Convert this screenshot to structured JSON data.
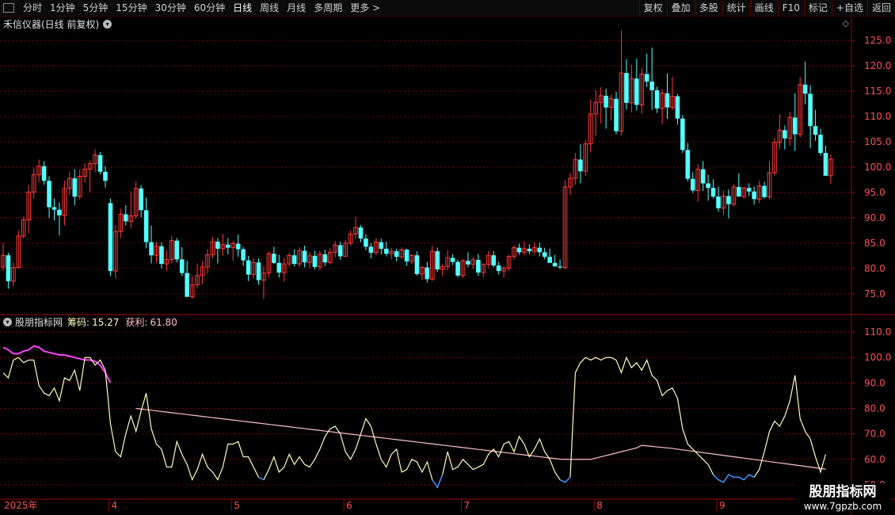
{
  "toolbar": {
    "periods": [
      "分时",
      "1分钟",
      "5分钟",
      "15分钟",
      "30分钟",
      "60分钟",
      "日线",
      "周线",
      "月线",
      "多周期",
      "更多 >"
    ],
    "active": "日线",
    "right_buttons": [
      "复权",
      "叠加",
      "多股",
      "统计",
      "画线",
      "F10",
      "标记",
      "+自选",
      "返回"
    ]
  },
  "main_panel": {
    "title": "禾信仪器(日线 前复权)",
    "price_axis": [
      "125.0",
      "120.0",
      "115.0",
      "110.0",
      "105.0",
      "100.0",
      "95.0",
      "90.0",
      "85.0",
      "80.0",
      "75.0"
    ]
  },
  "indicator_panel": {
    "name": "股朋指标网",
    "chip_label": "筹码:",
    "chip_value": "15.27",
    "profit_label": "获利:",
    "profit_value": "61.80",
    "axis": [
      "110.0",
      "100.0",
      "90.0",
      "80.0",
      "70.0",
      "60.0",
      "50.0"
    ]
  },
  "date_axis": [
    "2025年",
    "4",
    "5",
    "6",
    "7",
    "8",
    "9"
  ],
  "watermark": {
    "line1": "股朋指标网",
    "line2": "www.7gpzb.com"
  },
  "colors": {
    "up": "#ff3a3a",
    "down": "#54ffff",
    "grid": "#7a0000",
    "line_main": "#ffffc0",
    "line_avg": "#ffc0cb",
    "line_hi": "#ff40ff",
    "line_lo": "#3a8cff"
  },
  "chart_data": {
    "type": "candlestick",
    "price_ylim": [
      72,
      128
    ],
    "indicator_ylim": [
      45,
      115
    ],
    "month_boundaries": {
      "4": 21,
      "5": 45,
      "6": 67,
      "7": 90,
      "8": 116,
      "9": 140
    },
    "candles_ohlc": [
      [
        80.3,
        85.1,
        79.5,
        82.6
      ],
      [
        82.6,
        83.1,
        76,
        77.5
      ],
      [
        77.5,
        81.2,
        76.5,
        80.2
      ],
      [
        80.2,
        87.5,
        80,
        86.4
      ],
      [
        86.4,
        90.3,
        85.9,
        89.6
      ],
      [
        89.6,
        96.5,
        87,
        95.1
      ],
      [
        95.1,
        99.8,
        93.8,
        98.5
      ],
      [
        98.5,
        101.5,
        97,
        100.2
      ],
      [
        100.2,
        101.2,
        96.5,
        97.3
      ],
      [
        97.3,
        98.2,
        90,
        92.1
      ],
      [
        92.1,
        93.8,
        89.5,
        91.6
      ],
      [
        91.6,
        93,
        86.5,
        90.5
      ],
      [
        90.5,
        97.3,
        88.5,
        95.8
      ],
      [
        95.8,
        99,
        94.5,
        97.8
      ],
      [
        97.8,
        99.6,
        92.5,
        94.2
      ],
      [
        94.2,
        99.5,
        93.7,
        98.2
      ],
      [
        98.2,
        100.8,
        97,
        99.6
      ],
      [
        99.6,
        101.3,
        95,
        100.7
      ],
      [
        100.7,
        103.5,
        99,
        102.4
      ],
      [
        102.4,
        103,
        98.6,
        99.1
      ],
      [
        99.1,
        100.2,
        96,
        97.3
      ],
      [
        92.9,
        93.8,
        78.5,
        79.5
      ],
      [
        79.5,
        88.6,
        78,
        87.3
      ],
      [
        87.3,
        91.8,
        86,
        90.7
      ],
      [
        90.7,
        92.5,
        88.5,
        89.3
      ],
      [
        89.3,
        95.2,
        88,
        90.4
      ],
      [
        90.4,
        97.2,
        89.8,
        95.8
      ],
      [
        95.8,
        96.5,
        90.1,
        91.5
      ],
      [
        91.5,
        94,
        84,
        85.2
      ],
      [
        85.2,
        88.5,
        81,
        82.6
      ],
      [
        82.6,
        85.3,
        81.2,
        84.4
      ],
      [
        84.4,
        85.2,
        80,
        80.9
      ],
      [
        80.9,
        83.5,
        79.5,
        81.8
      ],
      [
        81.8,
        86.5,
        81,
        85.5
      ],
      [
        85.5,
        86,
        81.2,
        81.8
      ],
      [
        81.8,
        84.2,
        78.5,
        79.1
      ],
      [
        79.1,
        81.5,
        75,
        74.4
      ],
      [
        74.4,
        78.5,
        74,
        76.8
      ],
      [
        76.8,
        81,
        76,
        78.6
      ],
      [
        78.6,
        81.5,
        77,
        80.3
      ],
      [
        80.3,
        83.8,
        79,
        82.7
      ],
      [
        82.7,
        86.2,
        82,
        85.3
      ],
      [
        85.3,
        86,
        81,
        83.9
      ],
      [
        83.9,
        86.8,
        82.5,
        84.7
      ],
      [
        84.7,
        86,
        82.8,
        84.1
      ],
      [
        84.1,
        85.5,
        81.5,
        84.9
      ],
      [
        84.9,
        86.7,
        82.3,
        83.8
      ],
      [
        83.8,
        84.2,
        80.5,
        81.6
      ],
      [
        81.6,
        82.5,
        77.5,
        78.8
      ],
      [
        78.8,
        82,
        78,
        81.2
      ],
      [
        81.2,
        82,
        76.8,
        77.7
      ],
      [
        77.7,
        80.5,
        74,
        79.1
      ],
      [
        79.1,
        83.4,
        78.2,
        82.9
      ],
      [
        82.9,
        84.3,
        80.9,
        81.1
      ],
      [
        81.1,
        82.7,
        78.2,
        79.2
      ],
      [
        79.2,
        82.1,
        77.4,
        80.9
      ],
      [
        80.9,
        83.1,
        80.3,
        82.6
      ],
      [
        82.6,
        83.8,
        80.4,
        80.9
      ],
      [
        80.9,
        84.2,
        80.2,
        83.5
      ],
      [
        83.5,
        84.5,
        80.2,
        81.2
      ],
      [
        81.2,
        83.2,
        80.1,
        82.5
      ],
      [
        82.5,
        83.5,
        79.8,
        80.3
      ],
      [
        80.3,
        83.5,
        79.7,
        82.8
      ],
      [
        82.8,
        83.7,
        80.5,
        81.2
      ],
      [
        81.2,
        84,
        80.8,
        83.2
      ],
      [
        83.2,
        85.4,
        82.2,
        84.6
      ],
      [
        84.6,
        85.3,
        81.7,
        82.4
      ],
      [
        82.4,
        85.6,
        82.3,
        85
      ],
      [
        85,
        87.5,
        84.5,
        86.8
      ],
      [
        86.8,
        90.2,
        85.8,
        88.1
      ],
      [
        88.1,
        88.6,
        85.2,
        85.9
      ],
      [
        85.9,
        86.8,
        83.6,
        84.3
      ],
      [
        84.3,
        85,
        82,
        83.1
      ],
      [
        83.1,
        86,
        82.7,
        85.2
      ],
      [
        85.2,
        85.9,
        82.8,
        83.9
      ],
      [
        83.9,
        85.3,
        82.4,
        82.9
      ],
      [
        82.9,
        84.1,
        81.8,
        83.4
      ],
      [
        83.4,
        83.9,
        81.4,
        82.3
      ],
      [
        82.3,
        84.2,
        81.9,
        83.7
      ],
      [
        83.7,
        83.9,
        80.5,
        81.4
      ],
      [
        81.4,
        82.9,
        80.9,
        82.6
      ],
      [
        82.6,
        83.4,
        78.6,
        78.9
      ],
      [
        78.9,
        80.5,
        77.7,
        80.2
      ],
      [
        80.2,
        81.3,
        77.2,
        77.9
      ],
      [
        77.9,
        84.5,
        77.5,
        83.4
      ],
      [
        83.4,
        84.1,
        79.3,
        79.8
      ],
      [
        79.8,
        80.9,
        78.5,
        80.4
      ],
      [
        80.4,
        83.6,
        79.6,
        82.1
      ],
      [
        82.1,
        82.8,
        80.7,
        81.3
      ],
      [
        81.3,
        81.7,
        78.2,
        78.6
      ],
      [
        78.6,
        81.9,
        78.2,
        81.5
      ],
      [
        81.5,
        83.2,
        80.2,
        80.8
      ],
      [
        80.8,
        82.3,
        79.9,
        81.7
      ],
      [
        81.7,
        82.9,
        78.5,
        79.2
      ],
      [
        79.2,
        81,
        78.3,
        80.8
      ],
      [
        80.8,
        83.5,
        80.1,
        82.6
      ],
      [
        82.6,
        83.4,
        80.2,
        80.6
      ],
      [
        80.6,
        81.3,
        78.8,
        79.5
      ],
      [
        79.5,
        80.5,
        78.2,
        80.1
      ],
      [
        80.1,
        82.7,
        79.5,
        82.4
      ],
      [
        82.4,
        84.6,
        81.8,
        84.1
      ],
      [
        84.1,
        84.9,
        82.7,
        83.2
      ],
      [
        83.2,
        85.4,
        82.6,
        83.9
      ],
      [
        83.9,
        84.8,
        82.8,
        83.4
      ],
      [
        83.4,
        85.2,
        82.8,
        84.1
      ],
      [
        84.1,
        85.1,
        82.4,
        83.2
      ],
      [
        83.2,
        84.1,
        81.8,
        82.3
      ],
      [
        82.3,
        83.9,
        81.7,
        81.1
      ],
      [
        81.1,
        82.7,
        80.4,
        80.4
      ],
      [
        80.4,
        81.8,
        79.9,
        80.2
      ],
      [
        80.2,
        97.5,
        79.8,
        96.1
      ],
      [
        96.1,
        98.9,
        94.5,
        97.8
      ],
      [
        97.8,
        102.8,
        96.6,
        101.5
      ],
      [
        101.5,
        104.5,
        96.8,
        99.2
      ],
      [
        99.2,
        105.3,
        98.3,
        104.6
      ],
      [
        104.6,
        113.4,
        102.9,
        110.5
      ],
      [
        110.5,
        115.2,
        106.2,
        112.8
      ],
      [
        112.8,
        115.8,
        108.6,
        114.1
      ],
      [
        114.1,
        115.5,
        107.6,
        111.8
      ],
      [
        111.8,
        114.3,
        109.2,
        113.5
      ],
      [
        113.5,
        114.9,
        106.5,
        107.1
      ],
      [
        107.1,
        127,
        106.3,
        118.6
      ],
      [
        118.6,
        121.3,
        111.4,
        112.7
      ],
      [
        112.7,
        120.2,
        110.8,
        117.5
      ],
      [
        117.5,
        121.4,
        111.2,
        112.3
      ],
      [
        112.3,
        119.6,
        110.5,
        118.4
      ],
      [
        118.4,
        122.4,
        115.8,
        116.9
      ],
      [
        116.9,
        123.6,
        111.3,
        115.2
      ],
      [
        115.2,
        115.9,
        110.7,
        111.6
      ],
      [
        111.6,
        115.4,
        108.5,
        114.6
      ],
      [
        114.6,
        118.5,
        109.5,
        111.8
      ],
      [
        111.8,
        117.8,
        111.2,
        114
      ],
      [
        114,
        114.5,
        108.4,
        109.6
      ],
      [
        109.6,
        110.3,
        102.8,
        103.4
      ],
      [
        103.4,
        104.8,
        97.2,
        97.7
      ],
      [
        97.7,
        99,
        94.9,
        95.4
      ],
      [
        95.4,
        100.6,
        93.2,
        99.6
      ],
      [
        99.6,
        101.2,
        95.3,
        96.8
      ],
      [
        96.8,
        98.5,
        93.4,
        95.9
      ],
      [
        95.9,
        97.6,
        93.8,
        94.2
      ],
      [
        94.2,
        96.1,
        91.2,
        91.9
      ],
      [
        91.9,
        95.4,
        90.5,
        94.3
      ],
      [
        94.3,
        95.6,
        89.9,
        92.7
      ],
      [
        92.7,
        96.6,
        92.2,
        96.1
      ],
      [
        96.1,
        98.8,
        94.5,
        94.2
      ],
      [
        94.2,
        96.1,
        93.8,
        95.9
      ],
      [
        95.9,
        96.8,
        94.3,
        95.2
      ],
      [
        95.2,
        96.2,
        92.6,
        93.7
      ],
      [
        93.7,
        97.3,
        92.9,
        96.3
      ],
      [
        96.3,
        97.1,
        93.8,
        94.1
      ],
      [
        94.1,
        101.2,
        93.6,
        98.9
      ],
      [
        98.9,
        105.8,
        98.3,
        104.9
      ],
      [
        104.9,
        110.5,
        103.6,
        107.3
      ],
      [
        107.3,
        108.2,
        103.5,
        105.7
      ],
      [
        105.7,
        110.9,
        104.3,
        109.8
      ],
      [
        109.8,
        114.6,
        103.2,
        106.5
      ],
      [
        106.5,
        117.8,
        105.9,
        116.3
      ],
      [
        116.3,
        120.8,
        112.4,
        114.5
      ],
      [
        114.5,
        116.2,
        103.8,
        108.1
      ],
      [
        108.1,
        111.3,
        105.2,
        106.4
      ],
      [
        106.4,
        107.6,
        102.3,
        102.8
      ],
      [
        102.8,
        104.2,
        99.1,
        98.3
      ],
      [
        98.3,
        102.5,
        96.7,
        101.6
      ]
    ],
    "indicator_line": [
      94,
      92,
      99,
      100,
      98,
      99,
      99,
      89,
      86,
      85,
      88,
      83,
      92,
      91,
      95,
      87,
      100,
      100,
      97,
      99,
      95,
      74,
      63,
      61,
      70,
      77,
      71,
      79,
      86,
      72,
      66,
      64,
      57,
      57,
      67,
      62,
      58,
      52,
      56,
      62,
      57,
      55,
      52,
      57,
      66,
      66,
      67,
      61,
      61,
      57,
      53,
      52,
      56,
      61,
      55,
      57,
      62,
      58,
      61,
      58,
      57,
      60,
      64,
      69,
      72,
      73,
      70,
      63,
      60,
      64,
      70,
      76,
      73,
      66,
      60,
      57,
      62,
      64,
      55,
      56,
      60,
      59,
      55,
      59,
      52,
      49,
      54,
      63,
      56,
      57,
      60,
      58,
      56,
      57,
      58,
      62,
      64,
      61,
      66,
      67,
      63,
      69,
      66,
      61,
      64,
      68,
      63,
      60,
      55,
      52,
      51,
      53,
      94,
      98,
      100,
      99,
      100,
      99,
      100,
      100,
      99,
      94,
      100,
      96,
      98,
      95,
      99,
      93,
      91,
      85,
      87,
      88,
      84,
      72,
      66,
      64,
      62,
      60,
      58,
      54,
      52,
      51,
      54,
      53,
      53,
      52,
      54,
      53,
      56,
      63,
      71,
      75,
      73,
      77,
      83,
      93,
      76,
      71,
      68,
      61,
      55,
      62
    ]
  }
}
